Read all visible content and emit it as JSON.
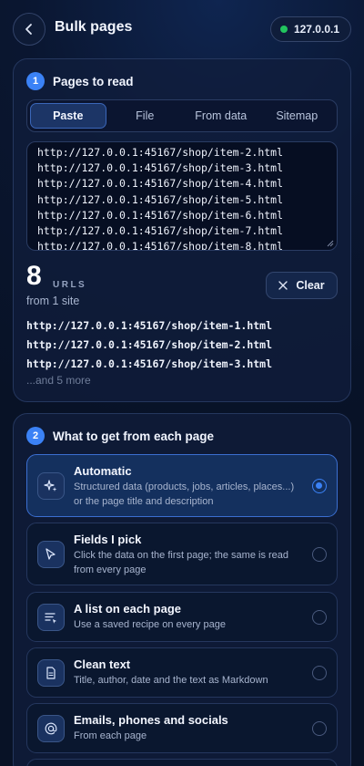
{
  "header": {
    "title": "Bulk pages",
    "host": "127.0.0.1"
  },
  "pages_card": {
    "step": "1",
    "title": "Pages to read",
    "tabs": [
      "Paste",
      "File",
      "From data",
      "Sitemap"
    ],
    "active_tab": "Paste",
    "textarea_lines": [
      "http://127.0.0.1:45167/shop/item-2.html",
      "http://127.0.0.1:45167/shop/item-3.html",
      "http://127.0.0.1:45167/shop/item-4.html",
      "http://127.0.0.1:45167/shop/item-5.html",
      "http://127.0.0.1:45167/shop/item-6.html",
      "http://127.0.0.1:45167/shop/item-7.html",
      "http://127.0.0.1:45167/shop/item-8.html"
    ],
    "count": "8",
    "count_label": "URLS",
    "count_sub": "from 1 site",
    "clear_label": "Clear",
    "preview": [
      "http://127.0.0.1:45167/shop/item-1.html",
      "http://127.0.0.1:45167/shop/item-2.html",
      "http://127.0.0.1:45167/shop/item-3.html"
    ],
    "more": "...and 5 more"
  },
  "extract_card": {
    "step": "2",
    "title": "What to get from each page",
    "options": [
      {
        "title": "Automatic",
        "desc": "Structured data (products, jobs, articles, places...) or the page title and description",
        "icon": "sparkles-icon",
        "selected": true
      },
      {
        "title": "Fields I pick",
        "desc": "Click the data on the first page; the same is read from every page",
        "icon": "cursor-icon",
        "selected": false
      },
      {
        "title": "A list on each page",
        "desc": "Use a saved recipe on every page",
        "icon": "list-icon",
        "selected": false
      },
      {
        "title": "Clean text",
        "desc": "Title, author, date and the text as Markdown",
        "icon": "document-icon",
        "selected": false
      },
      {
        "title": "Emails, phones and socials",
        "desc": "From each page",
        "icon": "at-icon",
        "selected": false
      }
    ]
  },
  "colors": {
    "accent": "#3b82f6",
    "status_dot": "#22c55e"
  }
}
